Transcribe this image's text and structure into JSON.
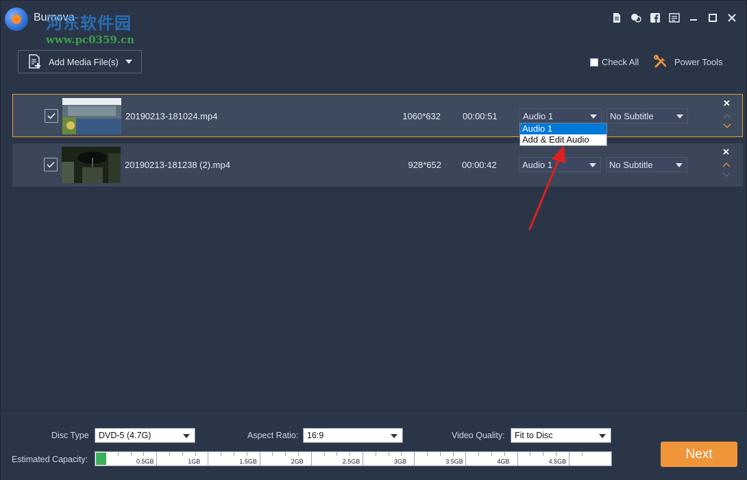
{
  "titlebar": {
    "app_title": "Burnova",
    "watermark_text": "河东软件园",
    "watermark_url": "www.pc0359.cn",
    "icons": [
      "document-icon",
      "chat-icon",
      "facebook-icon",
      "menu-icon",
      "minimize-icon",
      "maximize-icon",
      "close-icon"
    ]
  },
  "toolbar": {
    "add_media_label": "Add Media File(s)",
    "check_all_label": "Check All",
    "power_tools_label": "Power Tools"
  },
  "files": [
    {
      "name": "20190213-181024.mp4",
      "resolution": "1060*632",
      "duration": "00:00:51",
      "audio": "Audio 1",
      "subtitle": "No Subtitle",
      "checked": true,
      "selected": true
    },
    {
      "name": "20190213-181238 (2).mp4",
      "resolution": "928*652",
      "duration": "00:00:42",
      "audio": "Audio 1",
      "subtitle": "No Subtitle",
      "checked": true,
      "selected": false
    }
  ],
  "audio_dropdown": {
    "options": [
      "Audio 1",
      "Add & Edit Audio"
    ],
    "highlighted": "Audio 1"
  },
  "bottom": {
    "disc_type_label": "Disc Type",
    "disc_type_value": "DVD-5 (4.7G)",
    "aspect_ratio_label": "Aspect Ratio:",
    "aspect_ratio_value": "16:9",
    "video_quality_label": "Video Quality:",
    "video_quality_value": "Fit to Disc",
    "capacity_label": "Estimated Capacity:",
    "capacity_ticks": [
      "0.5GB",
      "1GB",
      "1.5GB",
      "2GB",
      "2.5GB",
      "3GB",
      "3.5GB",
      "4GB",
      "4.5GB"
    ],
    "capacity_used_fraction": 0.02,
    "next_label": "Next"
  },
  "colors": {
    "background": "#2b3548",
    "row": "#3b4659",
    "selected_border": "#e0a030",
    "accent": "#f0953a",
    "capacity_fill": "#3cb05a",
    "highlight": "#0078d7",
    "annotation_arrow": "#e02020"
  }
}
